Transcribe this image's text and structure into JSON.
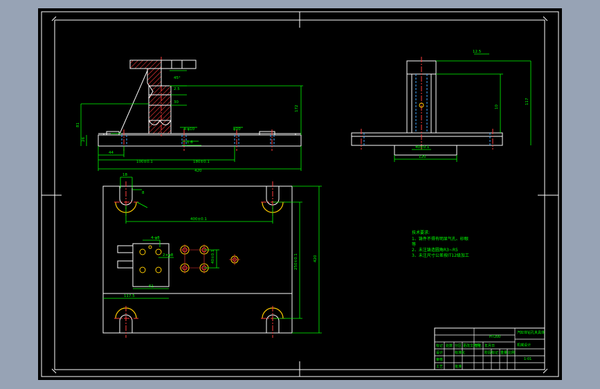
{
  "colors": {
    "background": "#000000",
    "frame": "#ffffff",
    "dimension": "#00ff00",
    "section_hatch": "#ff3b3b",
    "centerline": "#ff3b3b",
    "hidden_line": "#3fa9ff",
    "hole": "#ffcc00",
    "annotation": "#00ff00"
  },
  "views": {
    "front": {
      "dims": {
        "height_overall": "172",
        "height_left": "81",
        "base_thick": "26",
        "offset_left": "44",
        "len_100": "100±0.1",
        "len_180": "180±0.1",
        "len_total": "420",
        "hole1": "4-φ10",
        "hole2": "φ10",
        "chamfer1": "45°",
        "label_a": "2.5",
        "label_b": "30",
        "label_c": "1.6"
      }
    },
    "side": {
      "dims": {
        "height": "117",
        "inner": "10",
        "width_base": "120",
        "width_slot": "40±0.1",
        "roughness": "12.5"
      }
    },
    "top": {
      "dims": {
        "length": "400±0.1",
        "width": "250±0.1",
        "depth": "420",
        "small1": "18",
        "small2": "8",
        "small3": "4-φ8",
        "small4": "2×φ8",
        "small5": "40±0.1",
        "small6": "61",
        "small7": "117.5"
      }
    }
  },
  "notes": {
    "heading": "技术要求:",
    "items": [
      "1、铸件不得有明显气孔、砂眼",
      "等",
      "2、未注铸造圆角R3~R5",
      "3、未注尺寸公差按IT12级加工"
    ]
  },
  "title_block": {
    "material": "HT200",
    "title": "汽缸体钻孔夹具体",
    "school": "机械设计",
    "drawing_no": "1-01",
    "row_labels": [
      "标记",
      "处数",
      "分区",
      "更改文件号",
      "签名",
      "年月日"
    ],
    "sig_labels": [
      "设计",
      "标准化",
      "审核",
      "工艺",
      "批准"
    ],
    "stage": "阶段标记",
    "weight": "重量",
    "scale": "比例"
  }
}
